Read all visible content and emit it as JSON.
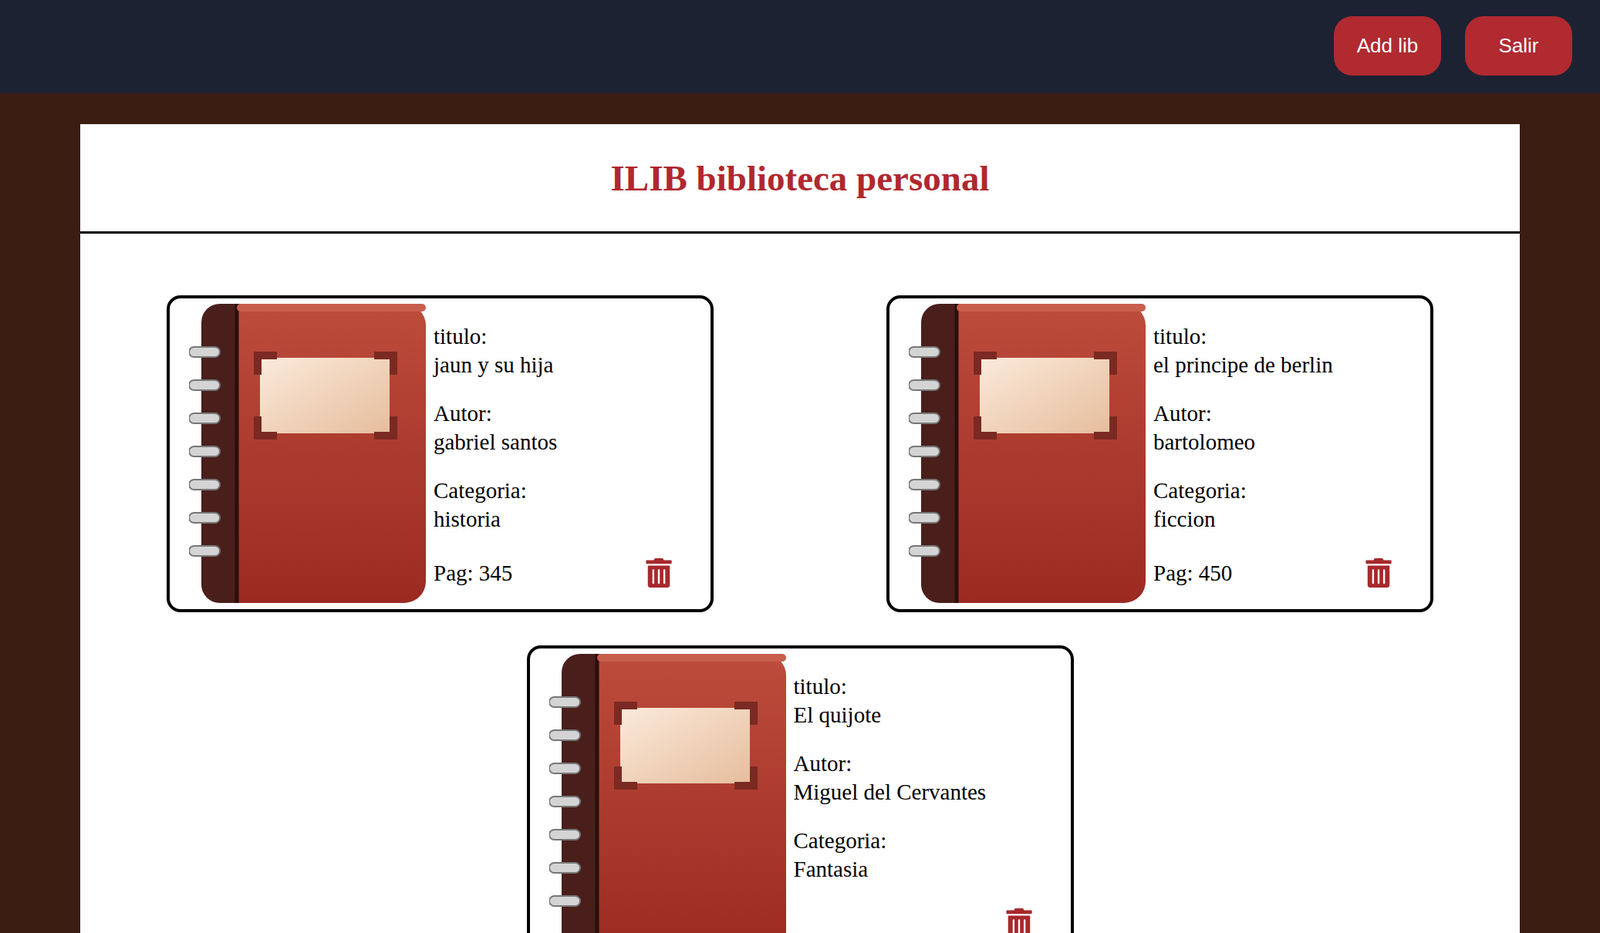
{
  "header": {
    "buttons": [
      {
        "label": "Add lib"
      },
      {
        "label": "Salir"
      }
    ]
  },
  "title": "ILIB biblioteca personal",
  "books": [
    {
      "fields": [
        {
          "label": "titulo:",
          "value": "jaun y su hija"
        },
        {
          "label": "Autor:",
          "value": "gabriel santos"
        },
        {
          "label": "Categoria:",
          "value": "historia"
        }
      ],
      "pages": "Pag: 345"
    },
    {
      "fields": [
        {
          "label": "titulo:",
          "value": "el principe de berlin"
        },
        {
          "label": "Autor:",
          "value": "bartolomeo"
        },
        {
          "label": "Categoria:",
          "value": "ficcion"
        }
      ],
      "pages": "Pag: 450"
    },
    {
      "fields": [
        {
          "label": "titulo:",
          "value": "El quijote"
        },
        {
          "label": "Autor:",
          "value": "Miguel del Cervantes"
        },
        {
          "label": "Categoria:",
          "value": "Fantasia"
        }
      ]
    }
  ]
}
